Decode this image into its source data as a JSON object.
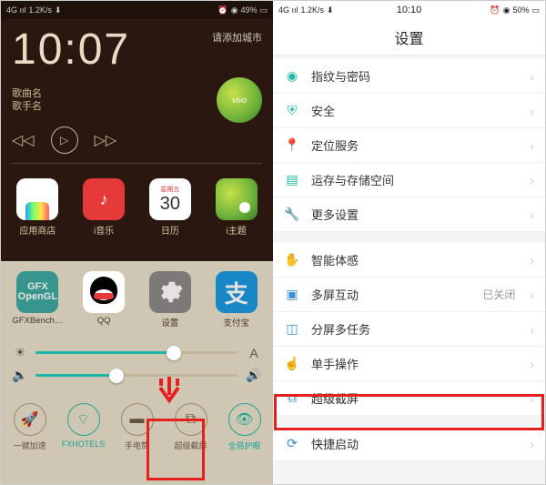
{
  "left": {
    "statusbar": {
      "net": "4G ııl",
      "speed": "1.2K/s",
      "down": "⬇",
      "wifi_icon": "wifi",
      "battery": "49%"
    },
    "clock": "10:07",
    "weather": "请添加城市",
    "song": {
      "title": "歌曲名",
      "artist": "歌手名"
    },
    "vivo": "vivo",
    "apps1": [
      {
        "label": "应用商店"
      },
      {
        "label": "i音乐"
      },
      {
        "label": "日历",
        "day": "30",
        "mon": "星期五"
      },
      {
        "label": "i主题"
      }
    ],
    "drawer_apps": [
      {
        "label": "GFXBench…",
        "line1": "GFX",
        "line2": "OpenGL"
      },
      {
        "label": "QQ"
      },
      {
        "label": "设置"
      },
      {
        "label": "支付宝",
        "glyph": "支"
      }
    ],
    "toggles": [
      {
        "label": "一键加速"
      },
      {
        "label": "FXHOTELS"
      },
      {
        "label": "手电筒"
      },
      {
        "label": "超级截屏"
      },
      {
        "label": "全局护眼"
      }
    ]
  },
  "right": {
    "statusbar": {
      "net": "4G ııl",
      "speed": "1.2K/s",
      "down": "⬇",
      "time": "10:10",
      "battery": "50%"
    },
    "title": "设置",
    "items": [
      {
        "label": "指纹与密码",
        "color": "#1bbaa8",
        "icon": "fingerprint"
      },
      {
        "label": "安全",
        "color": "#1bbaa8",
        "icon": "shield"
      },
      {
        "label": "定位服务",
        "color": "#1bbaa8",
        "icon": "pin"
      },
      {
        "label": "运存与存储空间",
        "color": "#1bbaa8",
        "icon": "sd"
      },
      {
        "label": "更多设置",
        "color": "#1bbaa8",
        "icon": "wrench"
      }
    ],
    "items2": [
      {
        "label": "智能体感",
        "color": "#3a8fd6",
        "icon": "hand"
      },
      {
        "label": "多屏互动",
        "color": "#3a8fd6",
        "icon": "screens",
        "value": "已关闭"
      },
      {
        "label": "分屏多任务",
        "color": "#3a8fd6",
        "icon": "split"
      },
      {
        "label": "单手操作",
        "color": "#3a8fd6",
        "icon": "onehand"
      },
      {
        "label": "超级截屏",
        "color": "#3a8fd6",
        "icon": "sshot",
        "highlight": true
      }
    ],
    "items3": [
      {
        "label": "快捷启动",
        "color": "#3a8fd6",
        "icon": "rocket"
      }
    ]
  }
}
